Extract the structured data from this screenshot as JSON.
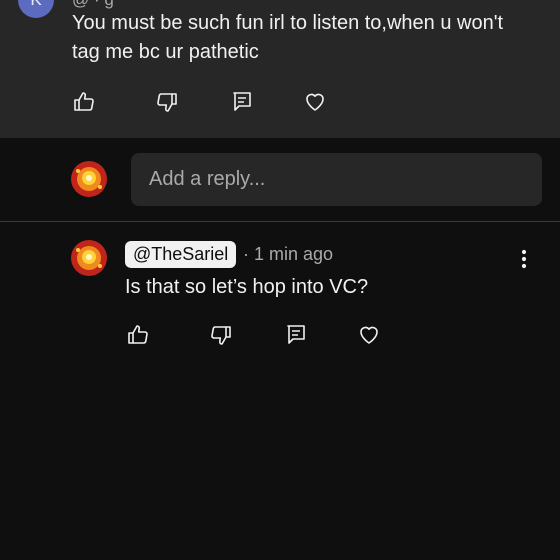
{
  "parent_comment": {
    "avatar_letter": "K",
    "header_partial": "@ · g",
    "text": "You must be such fun irl to listen to,when u won't tag me bc ur pathetic",
    "icons": {
      "like": "thumbs-up-icon",
      "dislike": "thumbs-down-icon",
      "reply": "comment-icon",
      "love": "heart-icon",
      "more": "more-vertical-icon"
    }
  },
  "composer": {
    "placeholder": "Add a reply..."
  },
  "reply_comment": {
    "author": "@TheSariel",
    "time": "· 1 min ago",
    "text": "Is that so let’s hop into VC?",
    "icons": {
      "like": "thumbs-up-icon",
      "dislike": "thumbs-down-icon",
      "reply": "comment-icon",
      "love": "heart-icon",
      "more": "more-vertical-icon"
    }
  },
  "colors": {
    "background": "#0f0f0f",
    "surface": "#272727",
    "text": "#f1f1f1",
    "secondary_text": "#aaaaaa",
    "avatar_k": "#5c6bc0"
  }
}
